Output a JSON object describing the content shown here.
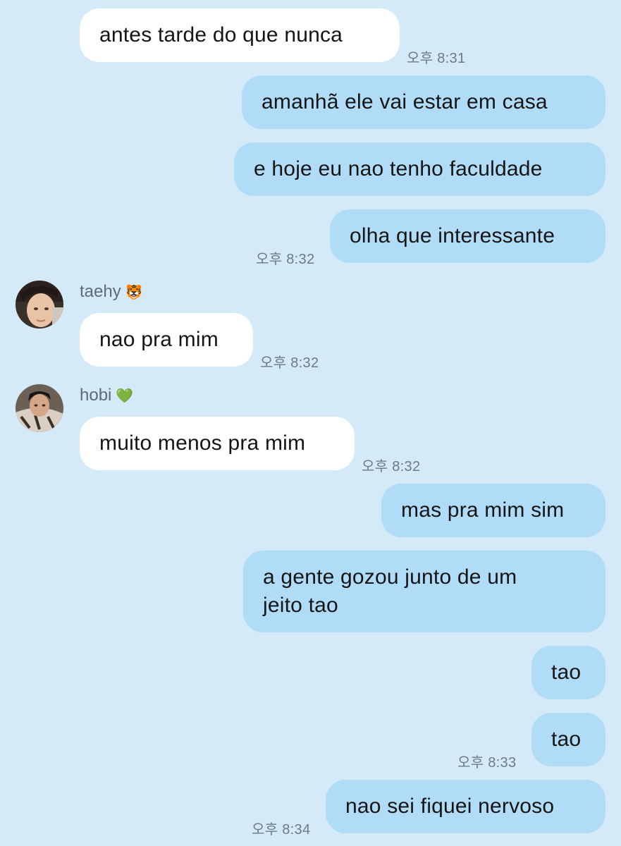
{
  "messages": [
    {
      "text": "antes tarde do que nunca",
      "time": "오후 8:31"
    },
    {
      "text": "amanhã ele vai estar em casa"
    },
    {
      "text": "e hoje eu nao tenho faculdade"
    },
    {
      "text": "olha que interessante",
      "time": "오후 8:32"
    },
    {
      "sender": "taehy",
      "sender_emoji": "🐯",
      "text": "nao pra mim",
      "time": "오후 8:32"
    },
    {
      "sender": "hobi",
      "sender_emoji": "💚",
      "text": "muito menos pra mim",
      "time": "오후 8:32"
    },
    {
      "text": "mas pra mim sim"
    },
    {
      "text_line1": "a gente gozou junto de um",
      "text_line2": "jeito tao"
    },
    {
      "text": "tao"
    },
    {
      "text": "tao",
      "time": "오후 8:33"
    },
    {
      "text": "nao sei fiquei nervoso",
      "time": "오후 8:34"
    }
  ],
  "colors": {
    "background": "#d4eaf9",
    "incoming_bubble": "#ffffff",
    "outgoing_bubble": "#b0dcf7",
    "timestamp": "#6b7b86"
  }
}
